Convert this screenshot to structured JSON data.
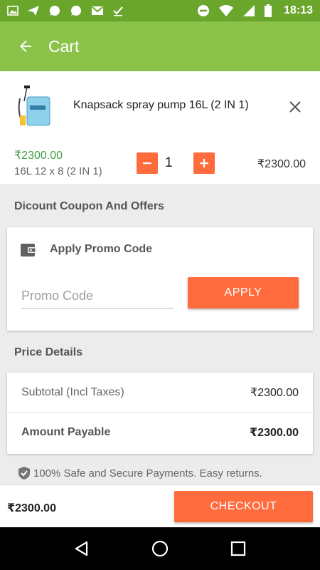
{
  "status_bar": {
    "time": "18:13",
    "left_icons": [
      "image-icon",
      "send-icon",
      "whatsapp-icon",
      "whatsapp-icon",
      "gmail-icon",
      "check-icon"
    ],
    "right_icons": [
      "do-not-disturb-icon",
      "wifi-icon",
      "signal-icon",
      "battery-icon"
    ]
  },
  "app_bar": {
    "title": "Cart",
    "back_icon": "arrow-back-icon",
    "color": "#8bc34a"
  },
  "cart_item": {
    "name": "Knapsack spray pump 16L (2 IN 1)",
    "unit_price": "₹2300.00",
    "variant": "16L 12 x 8 (2 IN 1)",
    "quantity": "1",
    "line_total": "₹2300.00"
  },
  "coupon": {
    "section_title": "Dicount Coupon And Offers",
    "heading": "Apply Promo Code",
    "input_placeholder": "Promo Code",
    "input_value": "",
    "apply_label": "APPLY"
  },
  "price_details": {
    "section_title": "Price Details",
    "subtotal_label": "Subtotal (Incl Taxes)",
    "subtotal_value": "₹2300.00",
    "payable_label": "Amount Payable",
    "payable_value": "₹2300.00"
  },
  "secure_note": "100% Safe and Secure Payments. Easy returns.",
  "bottom_bar": {
    "total": "₹2300.00",
    "checkout_label": "CHECKOUT"
  },
  "colors": {
    "accent": "#ff6b3d",
    "primary": "#8bc34a",
    "status_bar": "#6aa62b",
    "price_green": "#43a047"
  }
}
